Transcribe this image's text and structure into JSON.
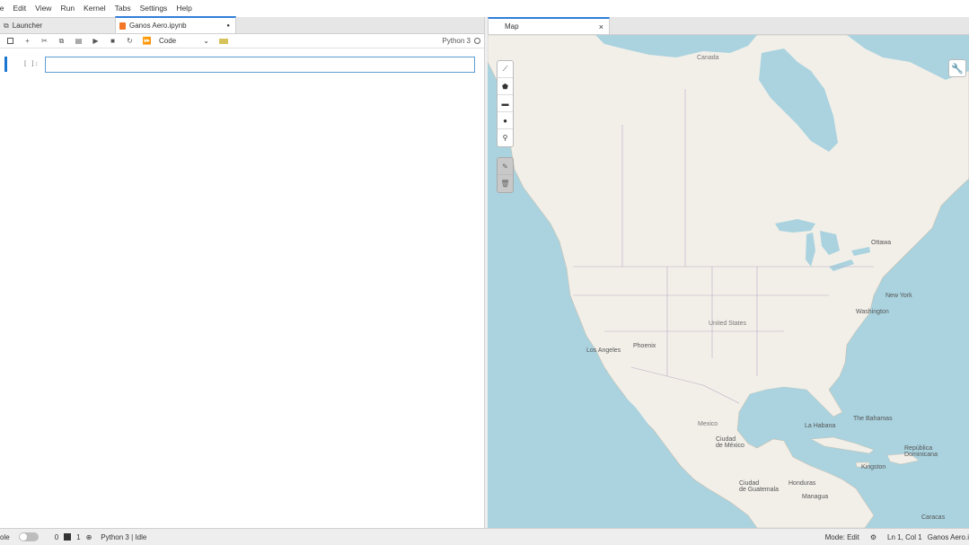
{
  "menubar": {
    "items": [
      "File",
      "Edit",
      "View",
      "Run",
      "Kernel",
      "Tabs",
      "Settings",
      "Help"
    ],
    "display_items": [
      "ile",
      "Edit",
      "View",
      "Run",
      "Kernel",
      "Tabs",
      "Settings",
      "Help"
    ]
  },
  "left_tabs": {
    "launcher_label": "Launcher",
    "notebook_label": "Ganos Aero.ipynb",
    "notebook_close": "●"
  },
  "toolbar": {
    "cell_type": "Code",
    "kernel_name": "Python 3"
  },
  "cell": {
    "prompt": "[ ]:",
    "value": ""
  },
  "right_tabs": {
    "map_label": "Map",
    "map_close": "×"
  },
  "map": {
    "labels": {
      "canada": "Canada",
      "ottawa": "Ottawa",
      "new_york": "New York",
      "washington": "Washington",
      "united_states": "United States",
      "phoenix": "Phoenix",
      "los_angeles": "Los Angeles",
      "mexico": "Mexico",
      "ciudad_mexico": "Ciudad\nde México",
      "la_habana": "La Habana",
      "bahamas": "The Bahamas",
      "kingston": "Kingston",
      "republica": "República\nDominicana",
      "honduras": "Honduras",
      "ciudad_guatemala": "Ciudad\nde Guatemala",
      "managua": "Managua",
      "caracas": "Caracas"
    },
    "colors": {
      "water": "#aad3df",
      "land": "#f2efe9",
      "border": "#b9a9c4"
    }
  },
  "statusbar": {
    "mode_prefix": "ole",
    "count_a": "0",
    "count_b": "1",
    "kernel_status": "Python 3 | Idle",
    "mode": "Mode: Edit",
    "position": "Ln 1, Col 1",
    "file": "Ganos Aero.i"
  },
  "icons": {
    "save": "save-icon",
    "add": "plus-icon",
    "cut": "scissors-icon",
    "copy": "copy-icon",
    "paste": "paste-icon",
    "run": "play-icon",
    "stop": "stop-icon",
    "restart": "restart-icon",
    "fast_forward": "fast-forward-icon"
  }
}
